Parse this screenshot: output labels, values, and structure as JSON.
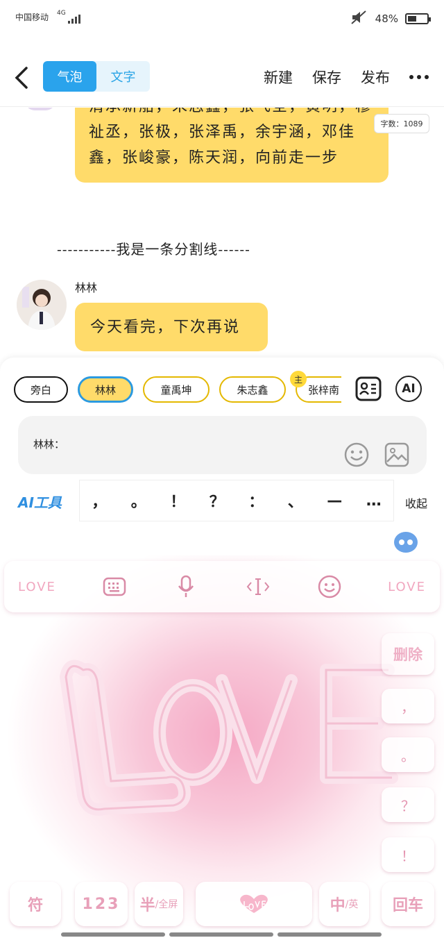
{
  "status_bar": {
    "carrier": "中国移动",
    "network": "4G",
    "battery": "48%"
  },
  "toolbar": {
    "tabs": [
      "气泡",
      "文字"
    ],
    "active_tab": "气泡",
    "actions": [
      "新建",
      "保存",
      "发布"
    ]
  },
  "chat": {
    "word_count": "字数：1089",
    "bubble1_lines": [
      "清承新船，朱志鑫，张飞全，黄明，穆",
      "祉丞，张极，张泽禹，余宇涵，邓佳",
      "鑫，张峻豪，陈天润，向前走一步"
    ],
    "divider": "-----------我是一条分割线------",
    "speaker_name": "林林",
    "bubble2_text": "今天看完，下次再说"
  },
  "composer": {
    "characters": [
      "旁白",
      "林林",
      "童禹坤",
      "朱志鑫",
      "张梓南"
    ],
    "selected_character": "林林",
    "main_badge": "主",
    "ai_button": "AI",
    "input_prefix": "林林：",
    "ai_tools": "AI工具",
    "punctuation": [
      "，",
      "。",
      "！",
      "？",
      "：",
      "、",
      "—",
      "…"
    ],
    "collapse": "收起"
  },
  "keyboard": {
    "bar_left": "LOVE",
    "bar_right": "LOVE",
    "delete": "删除",
    "side_keys": [
      "，",
      "。",
      "？",
      "！"
    ],
    "bottom_keys": {
      "symbol": "符",
      "numbers": "123",
      "half": "半",
      "fullscreen": "/全屏",
      "chinese": "中",
      "english": "/英",
      "enter": "回车"
    }
  },
  "colors": {
    "accent_blue": "#2aa3ec",
    "bubble_yellow": "#ffdb6a",
    "keyboard_pink": "#f5a8c4"
  }
}
